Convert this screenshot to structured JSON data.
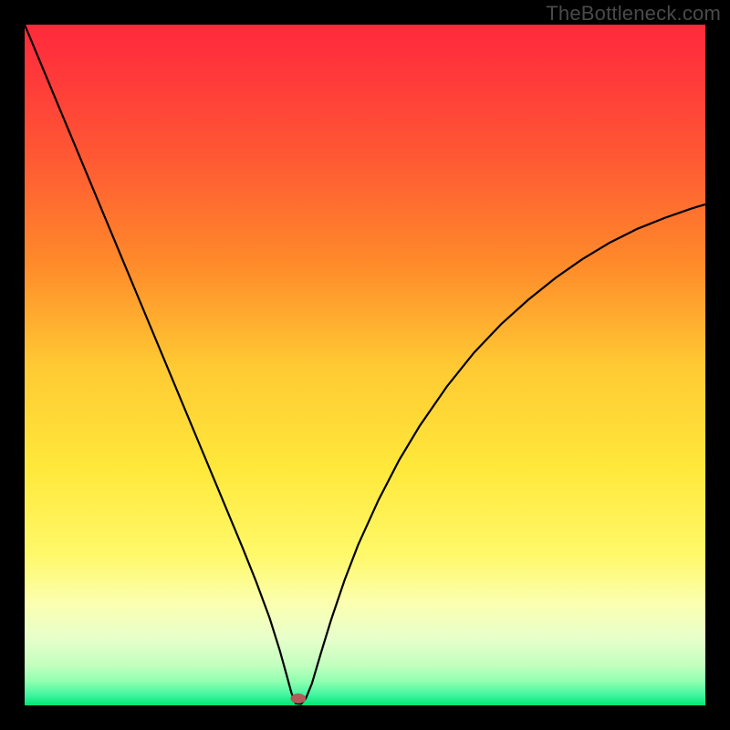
{
  "watermark": "TheBottleneck.com",
  "chart_data": {
    "type": "line",
    "title": "",
    "xlabel": "",
    "ylabel": "",
    "xlim": [
      0,
      100
    ],
    "ylim": [
      0,
      100
    ],
    "background_gradient": {
      "stops": [
        {
          "offset": 0.0,
          "color": "#ff2a3c"
        },
        {
          "offset": 0.08,
          "color": "#ff3a3a"
        },
        {
          "offset": 0.2,
          "color": "#ff5a33"
        },
        {
          "offset": 0.35,
          "color": "#ff8a2a"
        },
        {
          "offset": 0.5,
          "color": "#ffc933"
        },
        {
          "offset": 0.65,
          "color": "#ffe83a"
        },
        {
          "offset": 0.78,
          "color": "#fff96a"
        },
        {
          "offset": 0.85,
          "color": "#fbffb0"
        },
        {
          "offset": 0.9,
          "color": "#e8ffca"
        },
        {
          "offset": 0.94,
          "color": "#c4ffc0"
        },
        {
          "offset": 0.965,
          "color": "#8fffb0"
        },
        {
          "offset": 0.985,
          "color": "#40f5a0"
        },
        {
          "offset": 1.0,
          "color": "#00e673"
        }
      ]
    },
    "series": [
      {
        "name": "bottleneck-curve",
        "x": [
          0,
          2,
          5,
          8,
          11,
          14,
          17,
          20,
          23,
          26,
          29,
          32,
          34,
          36,
          37.5,
          38.5,
          39.2,
          39.8,
          40.6,
          41.3,
          42.2,
          43.5,
          45,
          47,
          49,
          52,
          55,
          58,
          62,
          66,
          70,
          74,
          78,
          82,
          86,
          90,
          94,
          98,
          100
        ],
        "y": [
          100,
          95.2,
          88.0,
          80.8,
          73.6,
          66.4,
          59.2,
          52.0,
          44.8,
          37.6,
          30.4,
          23.2,
          18.2,
          12.8,
          8.0,
          4.4,
          1.8,
          0.3,
          0.2,
          1.0,
          3.2,
          7.6,
          12.5,
          18.4,
          23.6,
          30.2,
          36.0,
          41.0,
          46.8,
          51.8,
          56.0,
          59.6,
          62.8,
          65.6,
          68.0,
          70.0,
          71.6,
          73.0,
          73.6
        ]
      }
    ],
    "marker": {
      "x": 40.2,
      "y": 1.0,
      "rx": 1.1,
      "ry": 0.7,
      "color": "#b55a5a"
    }
  }
}
